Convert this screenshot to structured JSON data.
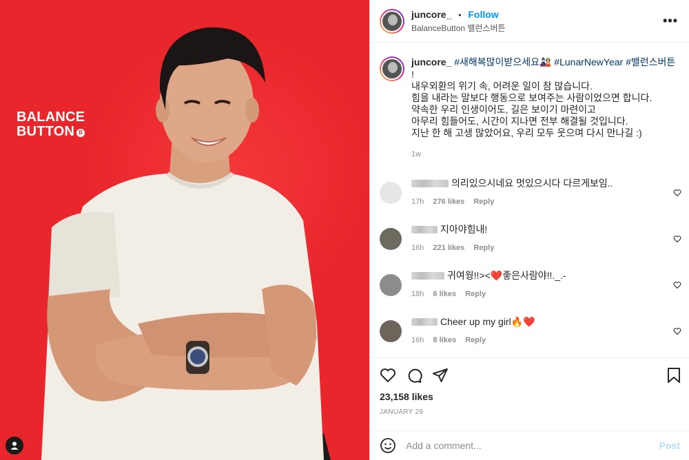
{
  "brand": {
    "line1": "BALANCE",
    "line2": "BUTTON",
    "badge": "B"
  },
  "header": {
    "username": "juncore_",
    "separator": "•",
    "follow_label": "Follow",
    "subline": "BalanceButton 밸런스버튼",
    "more_label": "•••"
  },
  "caption": {
    "username": "juncore_",
    "hashtag1": "#새해복많이받으세요",
    "emoji1": "🎎",
    "hashtag2": "#LunarNewYear",
    "hashtag3": "#밸런스버튼",
    "lines": [
      "!",
      "내우외환의 위기 속, 어려운 일이 참 많습니다.",
      "힘을 내라는 말보다 행동으로 보여주는 사람이었으면 합니다.",
      "약속한 우리 인생이어도, 길은 보이기 마련이고",
      "아무리 힘들어도, 시간이 지나면 전부 해결될 것입니다.",
      "지난 한 해 고생 많았어요, 우리 모두 웃으며 다시 만나길 :)"
    ],
    "time": "1w"
  },
  "comments": [
    {
      "text": "의리있으시네요 멋있으시다 다르게보임..",
      "time": "17h",
      "likes": "276 likes",
      "reply": "Reply",
      "avatar_color": "#e6e6e6"
    },
    {
      "text": "지아야힘내!",
      "time": "16h",
      "likes": "221 likes",
      "reply": "Reply",
      "avatar_color": "#6e6a60"
    },
    {
      "text": "귀여웡!!><❤️좋은사람야!!._.-",
      "time": "18h",
      "likes": "6 likes",
      "reply": "Reply",
      "avatar_color": "#8c8c8c"
    },
    {
      "text": "Cheer up my girl🔥❤️",
      "time": "16h",
      "likes": "8 likes",
      "reply": "Reply",
      "avatar_color": "#6d655c"
    }
  ],
  "actions": {
    "likes": "23,158 likes",
    "date": "JANUARY 29"
  },
  "add_comment": {
    "placeholder": "Add a comment...",
    "post_label": "Post"
  },
  "colors": {
    "accent": "#0095f6",
    "background_photo": "#e8262b",
    "hashtag": "#00376b"
  }
}
